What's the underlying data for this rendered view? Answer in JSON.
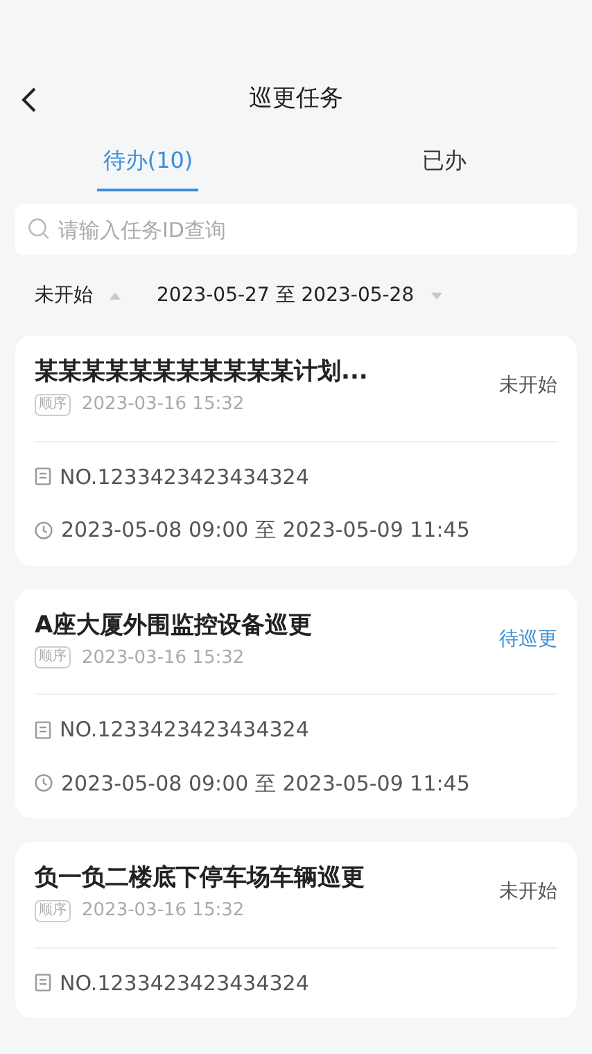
{
  "header": {
    "title": "巡更任务"
  },
  "tabs": [
    {
      "label": "待办(10)",
      "selected": true
    },
    {
      "label": "已办",
      "selected": false
    }
  ],
  "search": {
    "placeholder": "请输入任务ID查询"
  },
  "filters": [
    {
      "label": "未开始",
      "kind": "ascending"
    },
    {
      "label": "2023-05-27 至 2023-05-28",
      "kind": "descending"
    }
  ],
  "tasks": [
    {
      "title": "某某某某某某某某某某某计划...",
      "status": "未开始",
      "color": "#555555",
      "tag": "顺序",
      "created": "2023-03-16 15:32",
      "number": "NO.1233423423434324",
      "time": "2023-05-08 09:00 至 2023-05-09 11:45"
    },
    {
      "title": "A座大厦外围监控设备巡更",
      "status": "待巡更",
      "color": "#3b8fd9",
      "tag": "顺序",
      "created": "2023-03-16 15:32",
      "number": "NO.1233423423434324",
      "time": "2023-05-08 09:00 至 2023-05-09 11:45"
    },
    {
      "title": "负一负二楼底下停车场车辆巡更",
      "status": "未开始",
      "color": "#555555",
      "tag": "顺序",
      "created": "2023-03-16 15:32",
      "number": "NO.1233423423434324"
    }
  ]
}
